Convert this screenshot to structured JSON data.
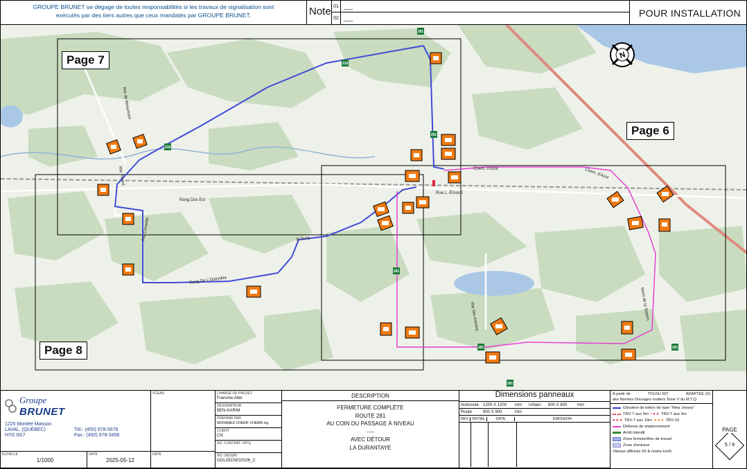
{
  "header": {
    "disclaimer_line1": "GROUPE BRUNET se dégage de toutes responsabilités si les travaux de signalisation sont",
    "disclaimer_line2": "exécutés par des tiers autres que ceux mandatés par GROUPE BRUNET.",
    "note_label": "Note",
    "notes": [
      {
        "num": "01",
        "value": "___"
      },
      {
        "num": "02",
        "value": "___"
      }
    ],
    "status": "POUR INSTALLATION"
  },
  "map": {
    "page_labels": [
      "Page 7",
      "Page 6",
      "Page 8"
    ],
    "road_labels": [
      "Chem. d'Azur",
      "Chem. d'Azur",
      "Rang Dos Est",
      "Rang De L'Ostrydéa",
      "Rte Picard",
      "Rte Cossette",
      "Rte de Beaumont",
      "Mont de la Station",
      "Rue L.-Émond",
      "St Surg.",
      "Rte Ste-Antoine"
    ],
    "route_shields": [
      "281",
      "218",
      "218",
      "281",
      "281",
      "281",
      "281",
      "281"
    ],
    "colors": {
      "detour": "#3f4ad6",
      "closure": "#e43fd1",
      "sign": "#f07a12",
      "woods": "#c9dcc0",
      "water": "#aac8e6",
      "highway": "#e08a80",
      "rail": "#999999"
    },
    "compass_letter": "N"
  },
  "title_block": {
    "company_line1": "Groupe",
    "company_line2": "BRUNET",
    "address_lines": [
      "1225 Montée Masson",
      "LAVAL, (QUÉBEC)",
      "H7G 0G7"
    ],
    "phone_label": "Tél.:",
    "phone": "(450) 978-5678",
    "fax_label": "Fax.:",
    "fax": "(450) 978-3456",
    "scale_label": "ÉCHELLE",
    "scale": "1/1000",
    "date_label": "DATE",
    "date": "2025-05-12",
    "seal_label": "SCEAU",
    "seal_date_label": "DATE",
    "fields": [
      {
        "label": "CHARGÉ DE PROJET",
        "value": "Francine Alter"
      },
      {
        "label": "DESSINATEUR",
        "value": "BEN-KARIM"
      },
      {
        "label": "PRÉPARÉ PAR",
        "value": "MOHAMED CHERIF CHEBBI ing."
      },
      {
        "label": "CLIENT",
        "value": "CN"
      },
      {
        "label": "NO. CONTRAT / MTQ",
        "value": ""
      },
      {
        "label": "NO. DESSIN",
        "value": "GGL25CN010106_C"
      }
    ],
    "description_title": "DESCRIPTION",
    "description_lines": [
      "FERMETURE COMPLÈTE",
      "ROUTE 281",
      "AU COIN DU PASSAGE À NIVEAU",
      "----",
      "AVEC DÉTOUR",
      "LA DURANTAYE"
    ],
    "dimensions_title": "Dimensions panneaux",
    "dim_autoroute_label": "Autoroute",
    "dim_autoroute": "1200 X 1200",
    "dim_urbain_label": "Urbain",
    "dim_urbain": "600 X 600",
    "dim_route_label": "Route",
    "dim_route": "900 X 900",
    "dim_unit": "mm",
    "revision_headers": [
      "REV",
      "INITIAL",
      "DATE",
      "ÉMISSION"
    ],
    "standard_prefix": "À partir de",
    "standard_doc": "TOLDU 007",
    "standard_adapted": "ADAPTÉE (S)",
    "standard_line": "des Normes Ouvrages routiers Tome V du M.T.Q.",
    "legend": [
      {
        "label": "Glissière de béton de type \"New Jersey\"",
        "color": "#2a3bd8"
      },
      {
        "label": "TRV-7 aux 5m",
        "color": "#e0243d"
      },
      {
        "label": "TRV-7 aux 5m",
        "color": "#e0243d"
      },
      {
        "label": "TRV-7 aux 10m",
        "color": "#e0243d"
      },
      {
        "label": "TRV-10",
        "color": "#f08a1e"
      },
      {
        "label": "Défense de stationnement",
        "color": "#e43fd1"
      },
      {
        "label": "Arrêt interdit",
        "color": "#2e8b2e"
      },
      {
        "label": "Zone fermée/Aire de travail",
        "color": "#9db7ea"
      },
      {
        "label": "Zone d'entrave",
        "color": "#c9c9f3"
      },
      {
        "label": "Vitesse affichée 60 & moins km/h",
        "color": ""
      }
    ],
    "page_label": "PAGE",
    "page_value": "5 / 8"
  }
}
